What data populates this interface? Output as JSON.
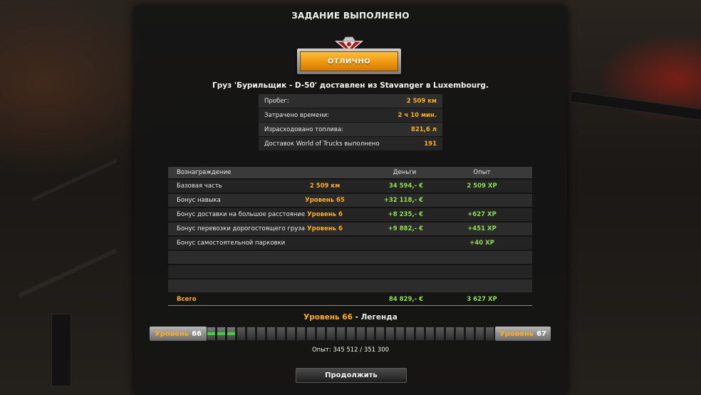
{
  "dialog": {
    "title": "ЗАДАНИЕ ВЫПОЛНЕНО",
    "rating": "ОТЛИЧНО",
    "cargo_line": "Груз 'Бурильщик - D-50' доставлен из Stavanger в Luxembourg."
  },
  "stats": [
    {
      "label": "Пробег:",
      "value": "2 509 км"
    },
    {
      "label": "Затрачено времени:",
      "value": "2 ч 10 мин."
    },
    {
      "label": "Израсходовано топлива:",
      "value": "821,6 л"
    },
    {
      "label": "Доставок World of Trucks выполнено",
      "value": "191"
    }
  ],
  "rewards": {
    "headers": {
      "name": "Вознаграждение",
      "money": "Деньги",
      "xp": "Опыт"
    },
    "rows": [
      {
        "name": "Базовая часть",
        "cond": "2 509 км",
        "money": "34 594,- €",
        "xp": "2 509 XP"
      },
      {
        "name": "Бонус навыка",
        "cond": "Уровень 65",
        "money": "+32 118,- €",
        "xp": ""
      },
      {
        "name": "Бонус доставки на большое расстояние",
        "cond": "Уровень 6",
        "money": "+8 235,- €",
        "xp": "+627 XP"
      },
      {
        "name": "Бонус перевозки дорогостоящего груза",
        "cond": "Уровень 6",
        "money": "+9 882,- €",
        "xp": "+451 XP"
      },
      {
        "name": "Бонус самостоятельной парковки",
        "cond": "",
        "money": "",
        "xp": "+40 XP"
      },
      {
        "name": "",
        "cond": "",
        "money": "",
        "xp": ""
      },
      {
        "name": "",
        "cond": "",
        "money": "",
        "xp": ""
      },
      {
        "name": "",
        "cond": "",
        "money": "",
        "xp": ""
      }
    ],
    "total": {
      "name": "Всего",
      "money": "84 829,- €",
      "xp": "3 627 XP"
    }
  },
  "level": {
    "prefix": "Уровень",
    "current": "66",
    "rank": "- Легенда",
    "word": "Уровень",
    "left_num": "66",
    "right_num": "67",
    "segments_total": 29,
    "segments_filled": 3,
    "xp_text": "Опыт: 345 512 / 351 300"
  },
  "buttons": {
    "continue": "Продолжить"
  },
  "colors": {
    "accent": "#ffad1e",
    "positive": "#8ee04a",
    "progress": "#3cd43c"
  }
}
